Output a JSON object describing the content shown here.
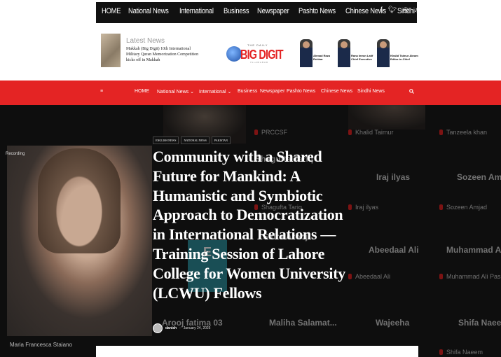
{
  "topnav": {
    "items": [
      "HOME",
      "National News",
      "International",
      "Business",
      "Newspaper",
      "Pashto News",
      "Chinese News",
      "Sindhi News"
    ],
    "social_icons": [
      "facebook-icon",
      "twitter-icon",
      "instagram-icon",
      "tiktok-icon"
    ]
  },
  "header": {
    "latest_title": "Latest News",
    "latest_text": "Makkah (Big Digit) 10th International Military Quran Memorization Competition kicks off in Makkah",
    "logo_small": "THE DAILY",
    "logo_text": "BIG DIGIT",
    "logo_sub": "ISLAMABAD",
    "people": [
      {
        "label": "Ahmad Raza Rehbar"
      },
      {
        "label": "Rana Imran Latif Chief Executive"
      },
      {
        "label": "Khalid Taimur Akram Editor-in-Chief"
      }
    ]
  },
  "rednav": {
    "menu_icon": "≡",
    "items": [
      "HOME",
      "National News ⌄",
      "International ⌄",
      "Business",
      "Newspaper",
      "Pashto News",
      "Chinese News",
      "Sindhi News"
    ],
    "search_icon": "search-icon"
  },
  "hero": {
    "recording": "Recording",
    "woman_label": "Maria Francesca Staiano",
    "grid_small": [
      "PRCCSF",
      "Khalid Taimur",
      "Tanzeela khan",
      "Shagufta Tariq",
      "Iraj ilyas",
      "Sozeen Amjad",
      "Abeedaal Ali",
      "Muhammad Ali Pasha",
      "Shifa Naeem"
    ],
    "grid_names": [
      "Shagufta Tariq",
      "Iraj ilyas",
      "Sozeen Amjad",
      "Sidra Arooj",
      "Abeedaal Ali",
      "Muhammad Ali",
      "Arooj fatima 03",
      "Maliha Salamat...",
      "Wajeeha",
      "Shifa Naeem"
    ],
    "tags": [
      "English News",
      "National News",
      "Pakistan"
    ],
    "headline": "Community with a Shared Future for Mankind: A Humanistic and Symbiotic Approach to Democratization in International Relations — Training Session of Lahore College for Women University (LCWU) Fellows",
    "author": "danish",
    "date": "January 24, 2025"
  }
}
